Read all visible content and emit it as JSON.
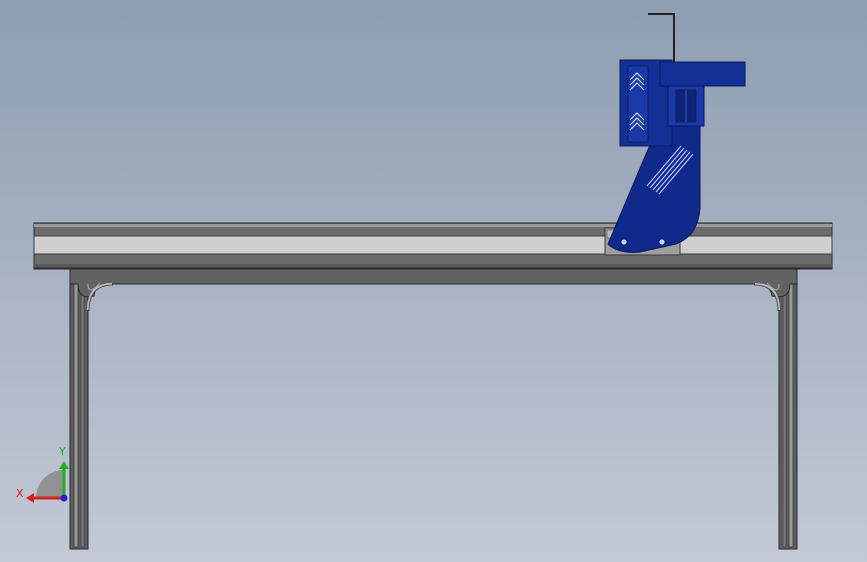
{
  "viewport": {
    "background_top": "#8e9db2",
    "background_bottom": "#c3c9d5"
  },
  "colors": {
    "frame_dark": "#4a4a4a",
    "frame_mid": "#707070",
    "frame_light": "#8c8c8c",
    "rail_light": "#cfcfcf",
    "carriage_blue": "#102a8c",
    "carriage_blue_light": "#2847b8",
    "axis_x": "#d42020",
    "axis_y": "#20b020",
    "axis_z": "#2020d0"
  },
  "triad": {
    "x_label": "X",
    "y_label": "Y",
    "icons": [
      "x-axis-arrow-icon",
      "y-axis-arrow-icon",
      "z-axis-dot-icon"
    ]
  }
}
